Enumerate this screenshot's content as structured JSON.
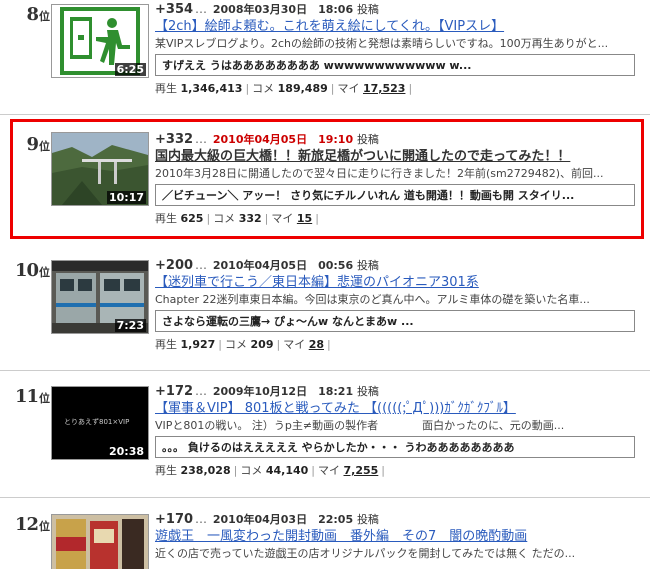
{
  "entries": [
    {
      "rank": "8",
      "suffix": "位",
      "points": "+354",
      "dots": "…",
      "date": "2008年03月30日　18:06",
      "post": "投稿",
      "title": "【2ch】絵師よ頼む。これを萌え絵にしてくれ。【VIPスレ】",
      "desc": "某VIPスレブログより。2chの絵師の技術と発想は素晴らしいですね。100万再生ありがと...",
      "comment": "すげええ うはああああああああ wwwwwwwwwwww w...",
      "views_label": "再生",
      "views": "1,346,413",
      "comments_label": "コメ",
      "comments": "189,489",
      "mylist_label": "マイ",
      "mylist": "17,523",
      "length": "6:25"
    },
    {
      "rank": "9",
      "suffix": "位",
      "points": "+332",
      "dots": "…",
      "date": "2010年04月05日　19:10",
      "post": "投稿",
      "title": "国内最大級の巨大橋！！新旅足橋がついに開通したので走ってみた！！",
      "desc": "2010年3月28日に開通したので翌々日に走りに行きました！2年前(sm2729482)、前回...",
      "comment": "／ビチューン＼ アッー！ さり気にチルノいれん 道も開通！！動画も開 スタイリ...",
      "views_label": "再生",
      "views": "625",
      "comments_label": "コメ",
      "comments": "332",
      "mylist_label": "マイ",
      "mylist": "15",
      "length": "10:17"
    },
    {
      "rank": "10",
      "suffix": "位",
      "points": "+200",
      "dots": "…",
      "date": "2010年04月05日　00:56",
      "post": "投稿",
      "title": "【迷列車で行こう／東日本編】悲運のパイオニア301系",
      "desc": "Chapter 22迷列車東日本編。今回は東京のど真ん中へ。アルミ車体の礎を築いた名車...",
      "comment": "さよなら運転の三鷹→ ぴょ～んw なんとまあw ...",
      "views_label": "再生",
      "views": "1,927",
      "comments_label": "コメ",
      "comments": "209",
      "mylist_label": "マイ",
      "mylist": "28",
      "length": "7:23"
    },
    {
      "rank": "11",
      "suffix": "位",
      "points": "+172",
      "dots": "…",
      "date": "2009年10月12日　18:21",
      "post": "投稿",
      "title": "【軍事＆VIP】 801板と戦ってみた 【(((((;ﾟДﾟ)))ｶﾞｸｶﾞｸﾌﾞﾙ】",
      "desc": "VIPと801の戦い。 注）うp主≠動画の製作者　　　　面白かったのに、元の動画...",
      "comment": "。。。 負けるのはえええええ やらかしたか・・・ うわああああああああ",
      "views_label": "再生",
      "views": "238,028",
      "comments_label": "コメ",
      "comments": "44,140",
      "mylist_label": "マイ",
      "mylist": "7,255",
      "length": "20:38"
    },
    {
      "rank": "12",
      "suffix": "位",
      "points": "+170",
      "dots": "…",
      "date": "2010年04月03日　22:05",
      "post": "投稿",
      "title": "遊戯王　一風変わった開封動画　番外編　その7　闇の晩酌動画",
      "desc": "近くの店で売っていた遊戯王の店オリジナルパックを開封してみたでは無く ただの...",
      "comment": "",
      "views_label": "",
      "views": "",
      "comments_label": "",
      "comments": "",
      "mylist_label": "",
      "mylist": "",
      "length": ""
    }
  ],
  "thumb_texts": {
    "t11": "とりあえず801×VIP"
  },
  "colors": {
    "highlight": "#e00000",
    "title_link": "#2a5bbd",
    "date_red": "#cc0000"
  }
}
